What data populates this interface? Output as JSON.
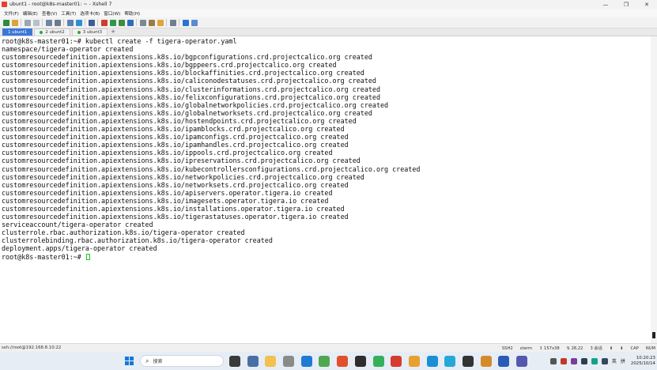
{
  "window": {
    "title": "ubunt1 - root@k8s-master01: ~ - Xshell 7",
    "controls": [
      "—",
      "❐",
      "✕"
    ]
  },
  "menu": [
    "文件(F)",
    "编辑(E)",
    "查看(V)",
    "工具(T)",
    "选项卡(B)",
    "窗口(W)",
    "帮助(H)"
  ],
  "toolbar": {
    "icons": [
      {
        "name": "new-session-icon",
        "color": "#2f8a3e"
      },
      {
        "name": "open-folder-icon",
        "color": "#d9a43a"
      },
      {
        "name": "sep"
      },
      {
        "name": "link-icon",
        "color": "#9aa7b5"
      },
      {
        "name": "unlink-icon",
        "color": "#b7c1cc"
      },
      {
        "name": "sep"
      },
      {
        "name": "copy-icon",
        "color": "#6f86a6"
      },
      {
        "name": "search-icon",
        "color": "#6b7b8d"
      },
      {
        "name": "sep"
      },
      {
        "name": "properties-icon",
        "color": "#5c7fb4"
      },
      {
        "name": "globe-icon",
        "color": "#2b8fd6"
      },
      {
        "name": "sep"
      },
      {
        "name": "font-icon",
        "color": "#3b5e9a"
      },
      {
        "name": "sep"
      },
      {
        "name": "xftp-icon",
        "color": "#d23a2e"
      },
      {
        "name": "xshell-icon",
        "color": "#2b9a46"
      },
      {
        "name": "fullscreen-icon",
        "color": "#3f8b3f"
      },
      {
        "name": "lock-icon",
        "color": "#2d6cc0"
      },
      {
        "name": "sep"
      },
      {
        "name": "keyboard-icon",
        "color": "#7e8893"
      },
      {
        "name": "script-icon",
        "color": "#9b7b4a"
      },
      {
        "name": "folder-icon",
        "color": "#e0a43b"
      },
      {
        "name": "sep"
      },
      {
        "name": "layout-icon",
        "color": "#6f7e90"
      },
      {
        "name": "sep"
      },
      {
        "name": "help-icon",
        "color": "#2a72d2"
      },
      {
        "name": "chat-icon",
        "color": "#5a8ad0"
      }
    ]
  },
  "tabs": [
    {
      "label": "1 ubunt1",
      "active": true
    },
    {
      "label": "2 ubunt2",
      "active": false
    },
    {
      "label": "3 ubunt3",
      "active": false
    }
  ],
  "tab_add": "+",
  "terminal": {
    "lines": [
      "root@k8s-master01:~# kubectl create -f tigera-operator.yaml",
      "namespace/tigera-operator created",
      "customresourcedefinition.apiextensions.k8s.io/bgpconfigurations.crd.projectcalico.org created",
      "customresourcedefinition.apiextensions.k8s.io/bgppeers.crd.projectcalico.org created",
      "customresourcedefinition.apiextensions.k8s.io/blockaffinities.crd.projectcalico.org created",
      "customresourcedefinition.apiextensions.k8s.io/caliconodestatuses.crd.projectcalico.org created",
      "customresourcedefinition.apiextensions.k8s.io/clusterinformations.crd.projectcalico.org created",
      "customresourcedefinition.apiextensions.k8s.io/felixconfigurations.crd.projectcalico.org created",
      "customresourcedefinition.apiextensions.k8s.io/globalnetworkpolicies.crd.projectcalico.org created",
      "customresourcedefinition.apiextensions.k8s.io/globalnetworksets.crd.projectcalico.org created",
      "customresourcedefinition.apiextensions.k8s.io/hostendpoints.crd.projectcalico.org created",
      "customresourcedefinition.apiextensions.k8s.io/ipamblocks.crd.projectcalico.org created",
      "customresourcedefinition.apiextensions.k8s.io/ipamconfigs.crd.projectcalico.org created",
      "customresourcedefinition.apiextensions.k8s.io/ipamhandles.crd.projectcalico.org created",
      "customresourcedefinition.apiextensions.k8s.io/ippools.crd.projectcalico.org created",
      "customresourcedefinition.apiextensions.k8s.io/ipreservations.crd.projectcalico.org created",
      "customresourcedefinition.apiextensions.k8s.io/kubecontrollersconfigurations.crd.projectcalico.org created",
      "customresourcedefinition.apiextensions.k8s.io/networkpolicies.crd.projectcalico.org created",
      "customresourcedefinition.apiextensions.k8s.io/networksets.crd.projectcalico.org created",
      "customresourcedefinition.apiextensions.k8s.io/apiservers.operator.tigera.io created",
      "customresourcedefinition.apiextensions.k8s.io/imagesets.operator.tigera.io created",
      "customresourcedefinition.apiextensions.k8s.io/installations.operator.tigera.io created",
      "customresourcedefinition.apiextensions.k8s.io/tigerastatuses.operator.tigera.io created",
      "serviceaccount/tigera-operator created",
      "clusterrole.rbac.authorization.k8s.io/tigera-operator created",
      "clusterrolebinding.rbac.authorization.k8s.io/tigera-operator created",
      "deployment.apps/tigera-operator created"
    ],
    "prompt": "root@k8s-master01:~# "
  },
  "statusbar": {
    "connection": "ssh://root@192.168.8.10:22",
    "items": [
      "SSH2",
      "xterm",
      "↕ 157x38",
      "⇅ 28,22",
      "3 会话",
      "⬆",
      "⬇",
      "CAP",
      "NUM"
    ]
  },
  "taskbar": {
    "search_placeholder": "搜索",
    "apps": [
      {
        "name": "widgets-icon",
        "color": "#3a3a3a"
      },
      {
        "name": "settings-icon",
        "color": "#4a6fa5"
      },
      {
        "name": "file-explorer-icon",
        "color": "#f2c14e"
      },
      {
        "name": "store-icon",
        "color": "#8a8a8a"
      },
      {
        "name": "vscode-icon",
        "color": "#1f7ad4"
      },
      {
        "name": "clipboard-icon",
        "color": "#4fa84f"
      },
      {
        "name": "xshell-taskbar-icon",
        "color": "#e0502e"
      },
      {
        "name": "terminal-icon",
        "color": "#2e2e2e"
      },
      {
        "name": "green-app-icon",
        "color": "#35b05a"
      },
      {
        "name": "red-app-icon",
        "color": "#d63b2f"
      },
      {
        "name": "chrome-icon",
        "color": "#e8a02e"
      },
      {
        "name": "edge-icon",
        "color": "#1b8fd6"
      },
      {
        "name": "chat-app-icon",
        "color": "#26a8d6"
      },
      {
        "name": "typora-icon",
        "color": "#333333"
      },
      {
        "name": "box-app-icon",
        "color": "#d48a2a"
      },
      {
        "name": "word-icon",
        "color": "#2b5cb5"
      },
      {
        "name": "teams-icon",
        "color": "#5558af"
      }
    ],
    "tray_icons": [
      {
        "name": "chevron-up-icon",
        "color": "#555555"
      },
      {
        "name": "tray-app1-icon",
        "color": "#c0392b"
      },
      {
        "name": "tray-app2-icon",
        "color": "#7d3c98"
      },
      {
        "name": "tray-app3-icon",
        "color": "#2c3e50"
      },
      {
        "name": "tray-app4-icon",
        "color": "#16a085"
      },
      {
        "name": "tray-app5-icon",
        "color": "#34495e"
      }
    ],
    "ime": "英",
    "ime_mode": "拼",
    "time": "10:20:23",
    "date": "2025/10/14"
  }
}
